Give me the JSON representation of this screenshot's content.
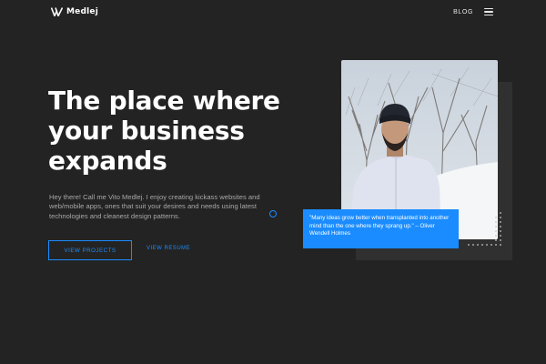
{
  "nav": {
    "brand": "Medlej",
    "blog_label": "BLOG",
    "logo_icon": "v-logo-icon",
    "menu_icon": "hamburger-menu-icon"
  },
  "hero": {
    "headline_line1": "The place where",
    "headline_line2": "your business",
    "headline_line3": "expands",
    "intro": "Hey there! Call me Vito Medlej. I enjoy creating kickass websites and web/mobile apps, ones that suit your desires and needs using latest technologies and cleanest design patterns.",
    "primary_button": "VIEW PROJECTS",
    "secondary_link": "VIEW RESUME"
  },
  "quote": {
    "text": "\"Many ideas grow better when transplanted into another mind than the one where they sprang up.\" – Oliver Wendell Holmes"
  },
  "colors": {
    "background": "#232323",
    "accent": "#1a8cff",
    "text": "#ffffff",
    "muted_text": "#a8a8a8"
  }
}
